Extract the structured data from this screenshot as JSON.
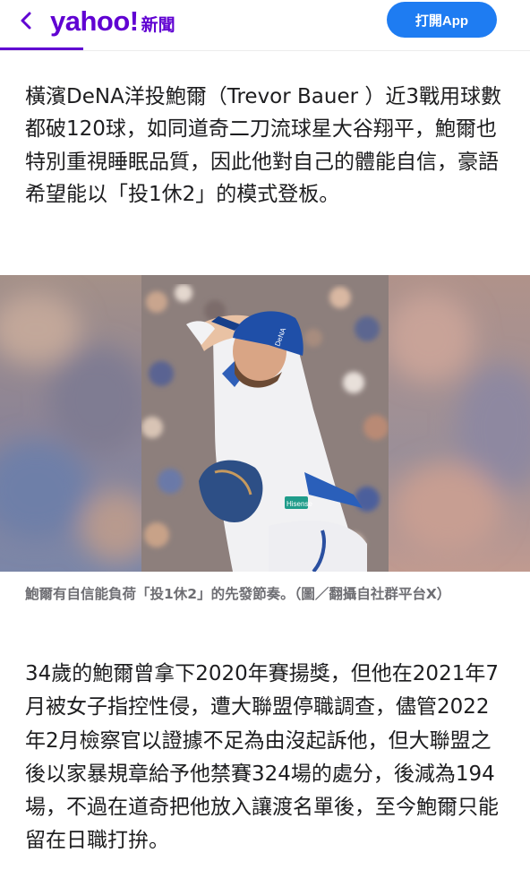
{
  "header": {
    "logo_text": "yahoo!",
    "section_text": "新聞",
    "open_app_label": "打開App",
    "brand_color": "#6001d2",
    "button_color": "#1e7cf2",
    "back_icon": "chevron-left-icon"
  },
  "article": {
    "paragraph_1": "橫濱DeNA洋投鮑爾（Trevor Bauer ）近3戰用球數都破120球，如同道奇二刀流球星大谷翔平，鮑爾也特別重視睡眠品質，因此他對自己的體能自信，豪語希望能以「投1休2」的模式登板。",
    "photo_caption": "鮑爾有自信能負荷「投1休2」的先發節奏。（圖／翻攝自社群平台X）",
    "paragraph_2": "34歲的鮑爾曾拿下2020年賽揚獎，但他在2021年7月被女子指控性侵，遭大聯盟停職調查，儘管2022年2月檢察官以證據不足為由沒起訴他，但大聯盟之後以家暴規章給予他禁賽324場的處分，後減為194場，不過在道奇把他放入讓渡名單後，至今鮑爾只能留在日職打拚。"
  },
  "photo": {
    "cap_logo_text": "DeNA",
    "sleeve_patch_text": "Hisense"
  }
}
